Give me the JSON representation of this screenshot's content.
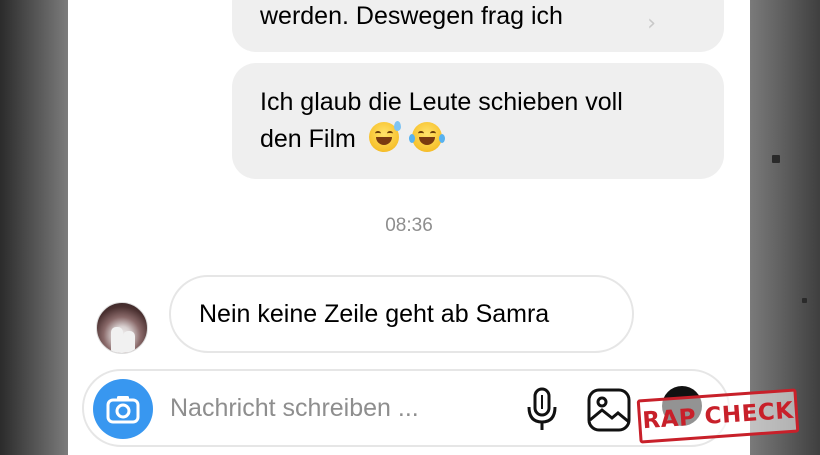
{
  "conversation": {
    "messages": [
      {
        "direction": "outgoing",
        "text": "werden. Deswegen frag ich"
      },
      {
        "direction": "outgoing",
        "text_line1": "Ich glaub die Leute schieben voll",
        "text_line2": "den Film",
        "emojis": [
          "sweat-smile-emoji",
          "tears-of-joy-emoji"
        ]
      },
      {
        "direction": "incoming",
        "text": "Nein keine Zeile geht ab Samra"
      }
    ],
    "timestamp": "08:36"
  },
  "composer": {
    "placeholder": "Nachricht schreiben ...",
    "icons": [
      "camera-icon",
      "microphone-icon",
      "gallery-icon",
      "sticker-icon"
    ]
  },
  "watermark": {
    "text": "RAP CHECK",
    "color": "#c8202a"
  },
  "colors": {
    "accent": "#3897f0",
    "bubble_gray": "#efefef",
    "timestamp": "#8e8e8e"
  }
}
